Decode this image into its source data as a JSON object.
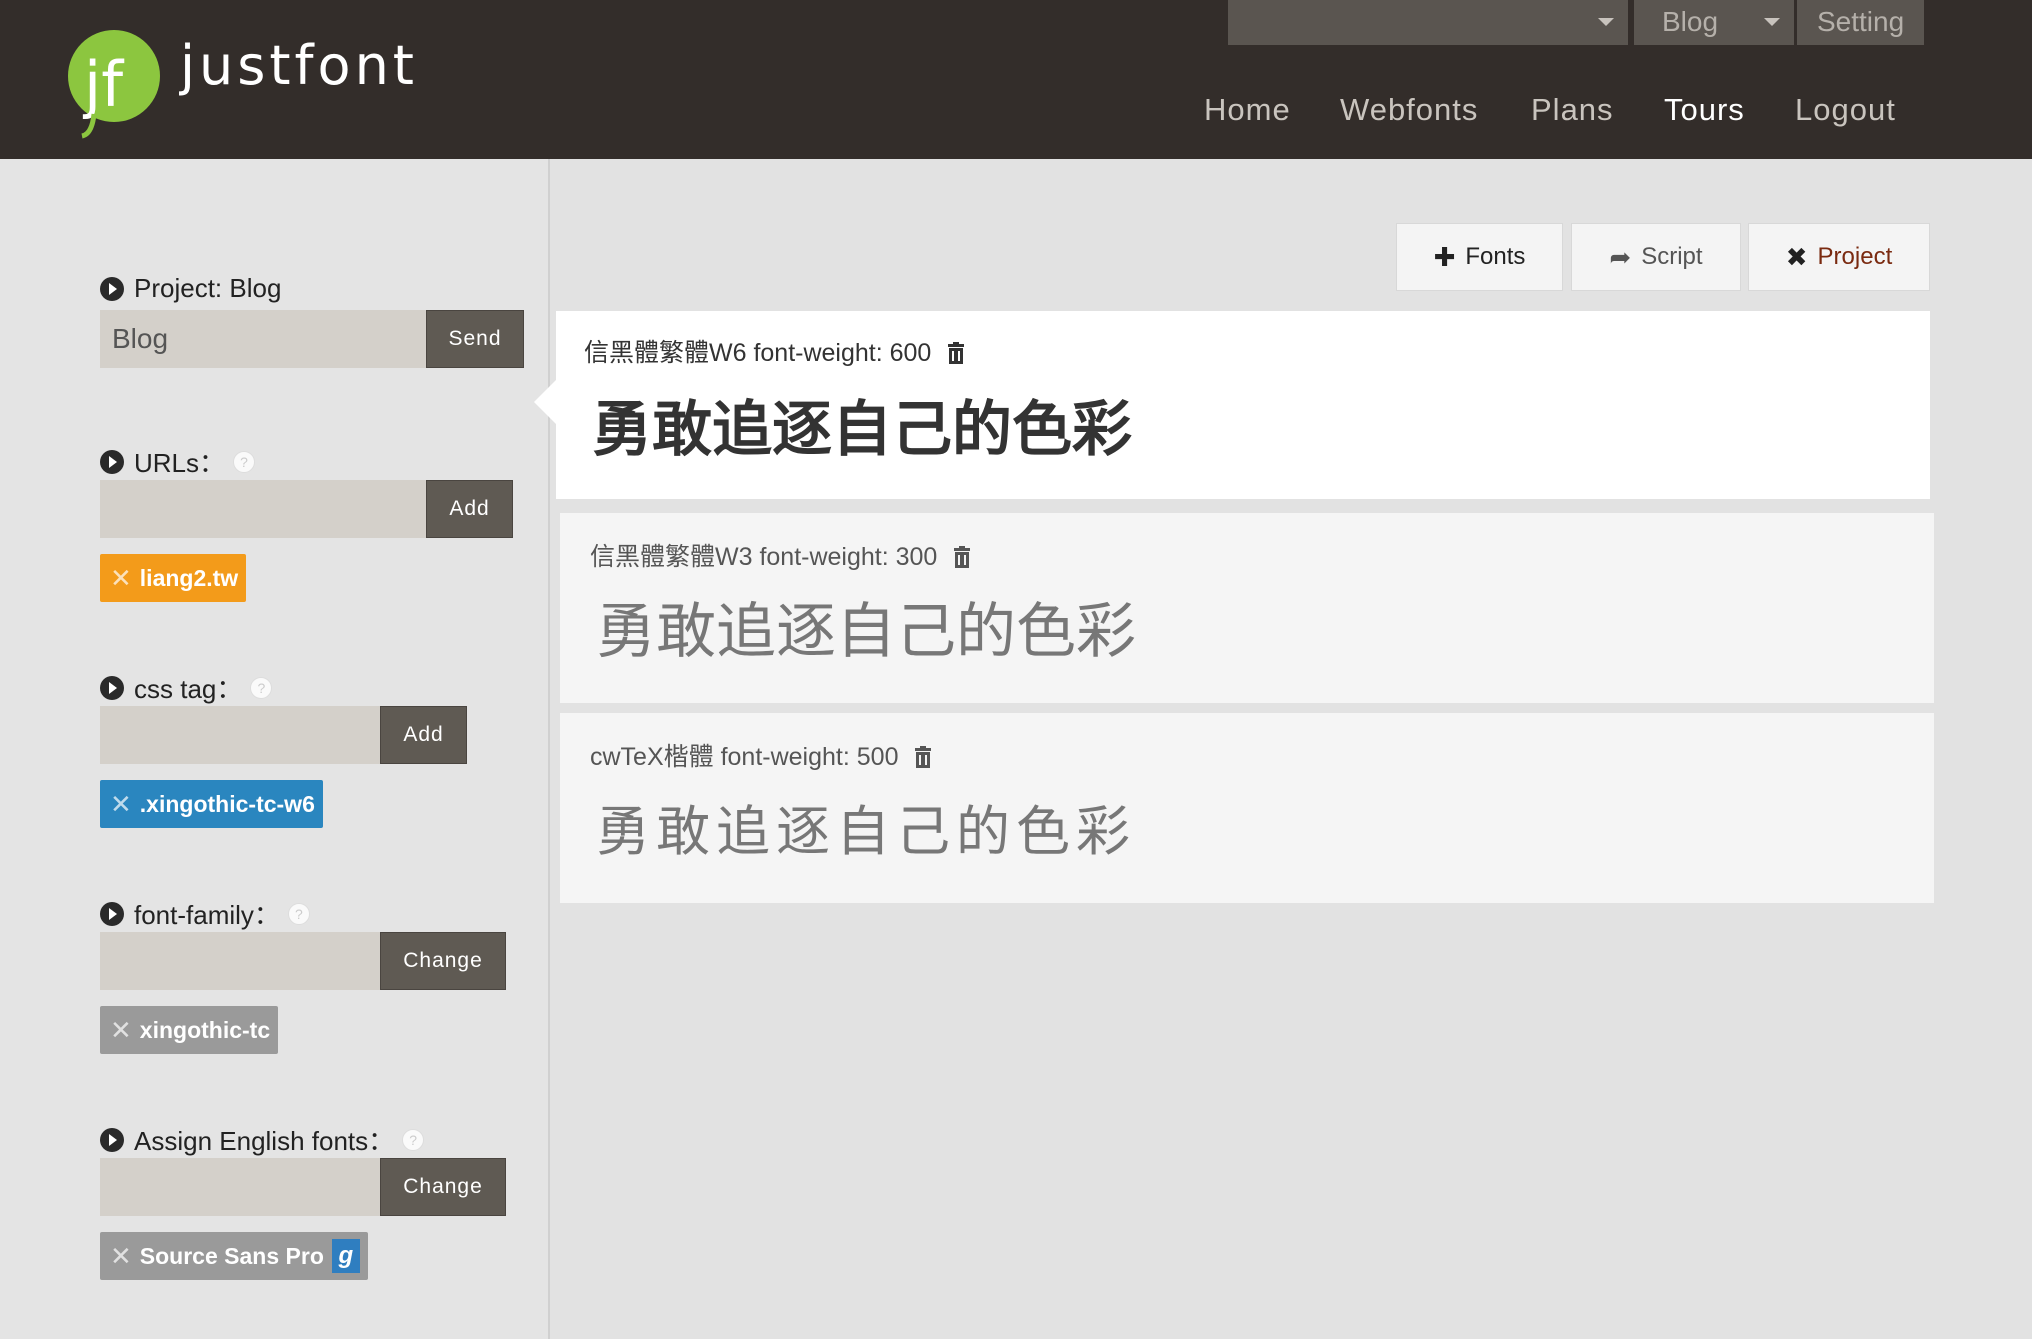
{
  "header": {
    "brand": "justfont",
    "top_dropdown_value": "",
    "top_blog_label": "Blog",
    "top_setting_label": "Setting",
    "nav": [
      {
        "label": "Home"
      },
      {
        "label": "Webfonts"
      },
      {
        "label": "Plans"
      },
      {
        "label": "Tours"
      },
      {
        "label": "Logout"
      }
    ]
  },
  "sidebar": {
    "project": {
      "label": "Project: Blog",
      "value": "Blog",
      "button": "Send"
    },
    "urls": {
      "label": "URLs：",
      "value": "",
      "button": "Add",
      "tags": [
        "liang2.tw"
      ]
    },
    "css_tag": {
      "label": "css tag：",
      "value": "",
      "button": "Add",
      "tags": [
        ".xingothic-tc-w6"
      ]
    },
    "font_family": {
      "label": "font-family：",
      "value": "",
      "button": "Change",
      "tags": [
        "xingothic-tc"
      ]
    },
    "english_fonts": {
      "label": "Assign English fonts：",
      "value": "",
      "button": "Change",
      "tags": [
        "Source Sans Pro"
      ],
      "badge": "g"
    }
  },
  "toolbar": {
    "fonts": "Fonts",
    "script": "Script",
    "project": "Project"
  },
  "fonts": [
    {
      "meta": "信黑體繁體W6 font-weight: 600",
      "sample": "勇敢追逐自己的色彩",
      "selected": true
    },
    {
      "meta": "信黑體繁體W3 font-weight: 300",
      "sample": "勇敢追逐自己的色彩",
      "selected": false
    },
    {
      "meta": "cwTeX楷體 font-weight: 500",
      "sample": "勇敢追逐自己的色彩",
      "selected": false
    }
  ],
  "colors": {
    "header_bg": "#332d2a",
    "accent_orange": "#f39b1a",
    "accent_blue": "#2a86bf",
    "logo_green": "#8cc63f",
    "button_dark": "#5f5a53"
  }
}
